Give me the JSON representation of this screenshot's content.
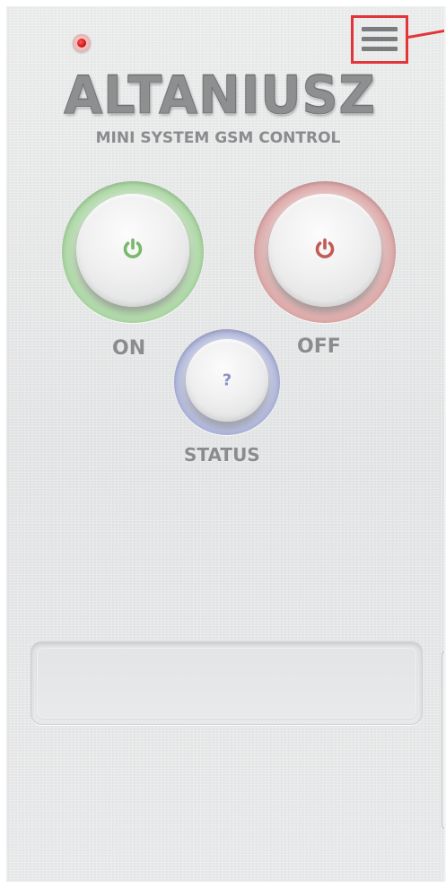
{
  "header": {
    "menu_icon": "hamburger-menu-icon",
    "status_led_color": "#d41414",
    "highlight_color": "#e3343a"
  },
  "branding": {
    "title": "ALTANIUSZ",
    "subtitle": "MINI SYSTEM GSM CONTROL"
  },
  "controls": {
    "on": {
      "label": "ON",
      "icon": "power-icon",
      "color": "#79b86d"
    },
    "off": {
      "label": "OFF",
      "icon": "power-icon",
      "color": "#c35b55"
    },
    "status": {
      "label": "STATUS",
      "icon_text": "?",
      "color": "#8b93c6"
    }
  },
  "message_display": {
    "text": ""
  }
}
